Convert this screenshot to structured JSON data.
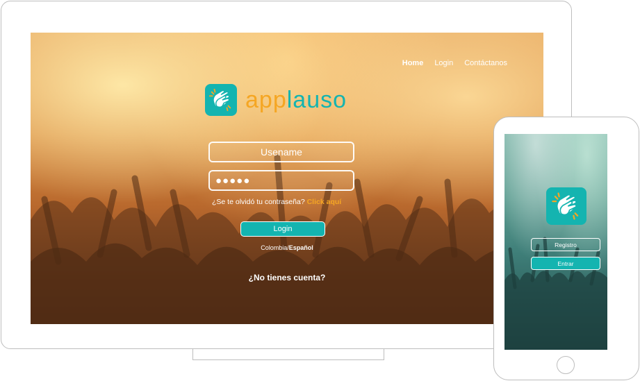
{
  "desktop": {
    "nav": {
      "home": "Home",
      "login": "Login",
      "contact": "Contáctanos"
    },
    "logo": {
      "part1": "app",
      "part2": "lauso"
    },
    "username_placeholder": "Usename",
    "password_mask": "●●●●●",
    "forgot": {
      "text": "¿Se te olvidó tu contraseña?",
      "link": "Click aquí"
    },
    "login_button": "Login",
    "locale": {
      "country": "Colombia/",
      "language": "Español"
    },
    "no_account": "¿No tienes cuenta?"
  },
  "mobile": {
    "register_button": "Registro",
    "enter_button": "Entrar"
  },
  "colors": {
    "teal": "#14b4b0",
    "orange": "#f5a623"
  }
}
